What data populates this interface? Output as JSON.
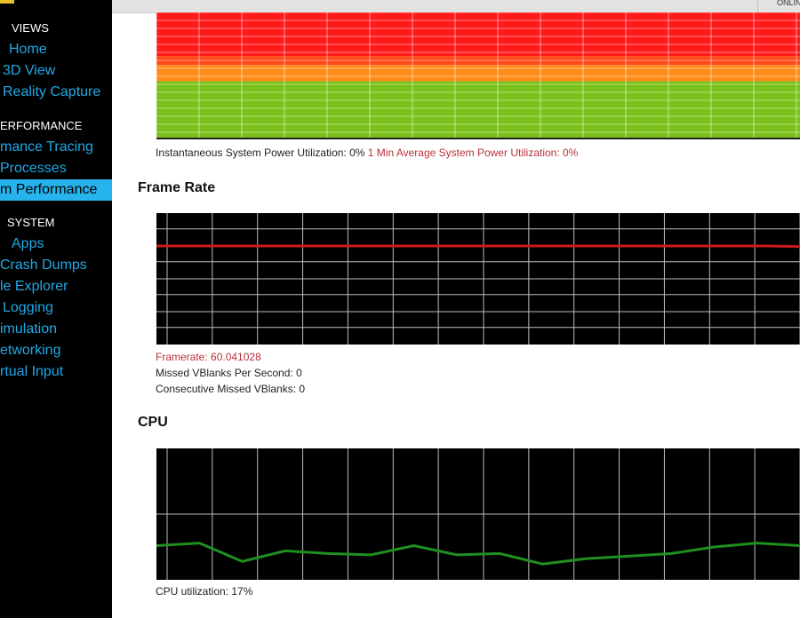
{
  "sidebar": {
    "views_heading": "VIEWS",
    "performance_heading": "ERFORMANCE",
    "system_heading": "SYSTEM",
    "items": [
      {
        "label": "Home"
      },
      {
        "label": "3D View"
      },
      {
        "label": "Reality Capture"
      },
      {
        "label": "mance Tracing"
      },
      {
        "label": "Processes"
      },
      {
        "label": "m Performance"
      },
      {
        "label": "Apps"
      },
      {
        "label": "Crash Dumps"
      },
      {
        "label": "le Explorer"
      },
      {
        "label": "Logging"
      },
      {
        "label": "imulation"
      },
      {
        "label": "etworking"
      },
      {
        "label": "rtual Input"
      }
    ],
    "selected_index": 5
  },
  "topbar": {
    "status": "ONLIN"
  },
  "power": {
    "instantaneous": "Instantaneous System Power Utilization: 0%",
    "average": "1 Min Average System Power Utilization: 0%",
    "bands": [
      {
        "color": "#ff1a1a",
        "fraction": 0.35
      },
      {
        "color": "#ff4a1a",
        "fraction": 0.07
      },
      {
        "color": "#ff8c1a",
        "fraction": 0.13
      },
      {
        "color": "#7ac01a",
        "fraction": 0.45
      }
    ]
  },
  "frame_rate": {
    "title": "Frame Rate",
    "framerate": "Framerate: 60.041028",
    "missed": "Missed VBlanks Per Second: 0",
    "consecutive": "Consecutive Missed VBlanks: 0",
    "line_color": "#cc1a1a",
    "y_values": [
      60,
      60,
      60,
      60,
      60,
      60,
      60,
      60,
      60,
      60,
      60,
      60,
      60,
      60,
      60,
      60,
      60,
      60,
      60,
      59.6
    ]
  },
  "cpu": {
    "title": "CPU",
    "utilization": "CPU utilization: 17%",
    "line_color": "#1f8f1f",
    "y_values": [
      26,
      28,
      14,
      22,
      20,
      19,
      26,
      19,
      20,
      12,
      16,
      18,
      20,
      25,
      28,
      26
    ]
  },
  "colors": {
    "accent": "#27b3ec",
    "nav_text": "#1fa9e6",
    "alert_text": "#b5313a"
  }
}
